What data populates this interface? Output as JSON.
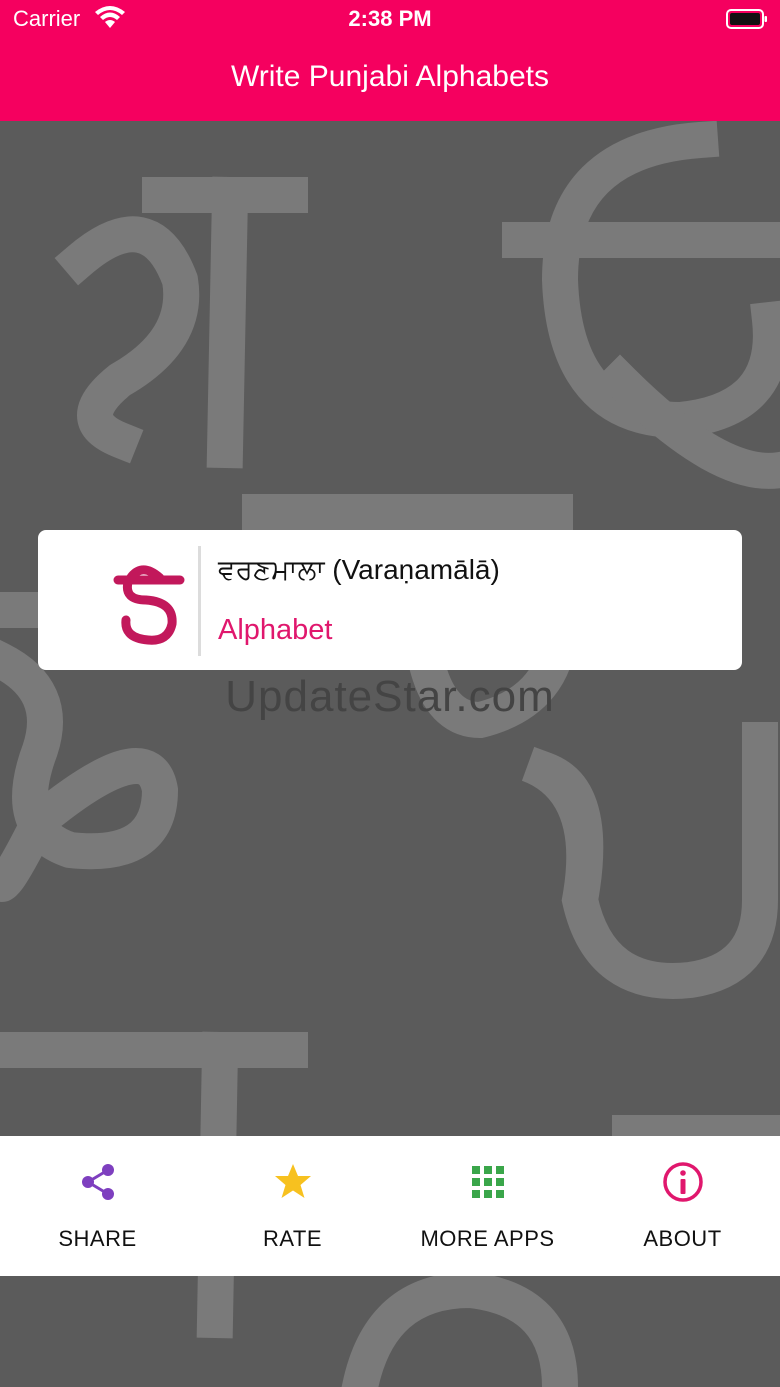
{
  "status_bar": {
    "carrier": "Carrier",
    "time": "2:38 PM"
  },
  "app": {
    "title": "Write Punjabi Alphabets"
  },
  "card": {
    "title": "ਵਰਣਮਾਲਾ (Varaṇamālā)",
    "subtitle": "Alphabet",
    "icon": "gurmukhi-oora-letter"
  },
  "watermark": "UpdateStar.com",
  "bottom_bar": {
    "items": [
      {
        "label": "SHARE",
        "icon": "share-icon",
        "color": "#7e3fbf"
      },
      {
        "label": "RATE",
        "icon": "star-icon",
        "color": "#f7c11f"
      },
      {
        "label": "MORE APPS",
        "icon": "grid-icon",
        "color": "#3aa64a"
      },
      {
        "label": "ABOUT",
        "icon": "info-icon",
        "color": "#e0176d"
      }
    ]
  },
  "colors": {
    "brand": "#f5005f",
    "accent": "#e0176d",
    "background": "#5b5b5b"
  }
}
